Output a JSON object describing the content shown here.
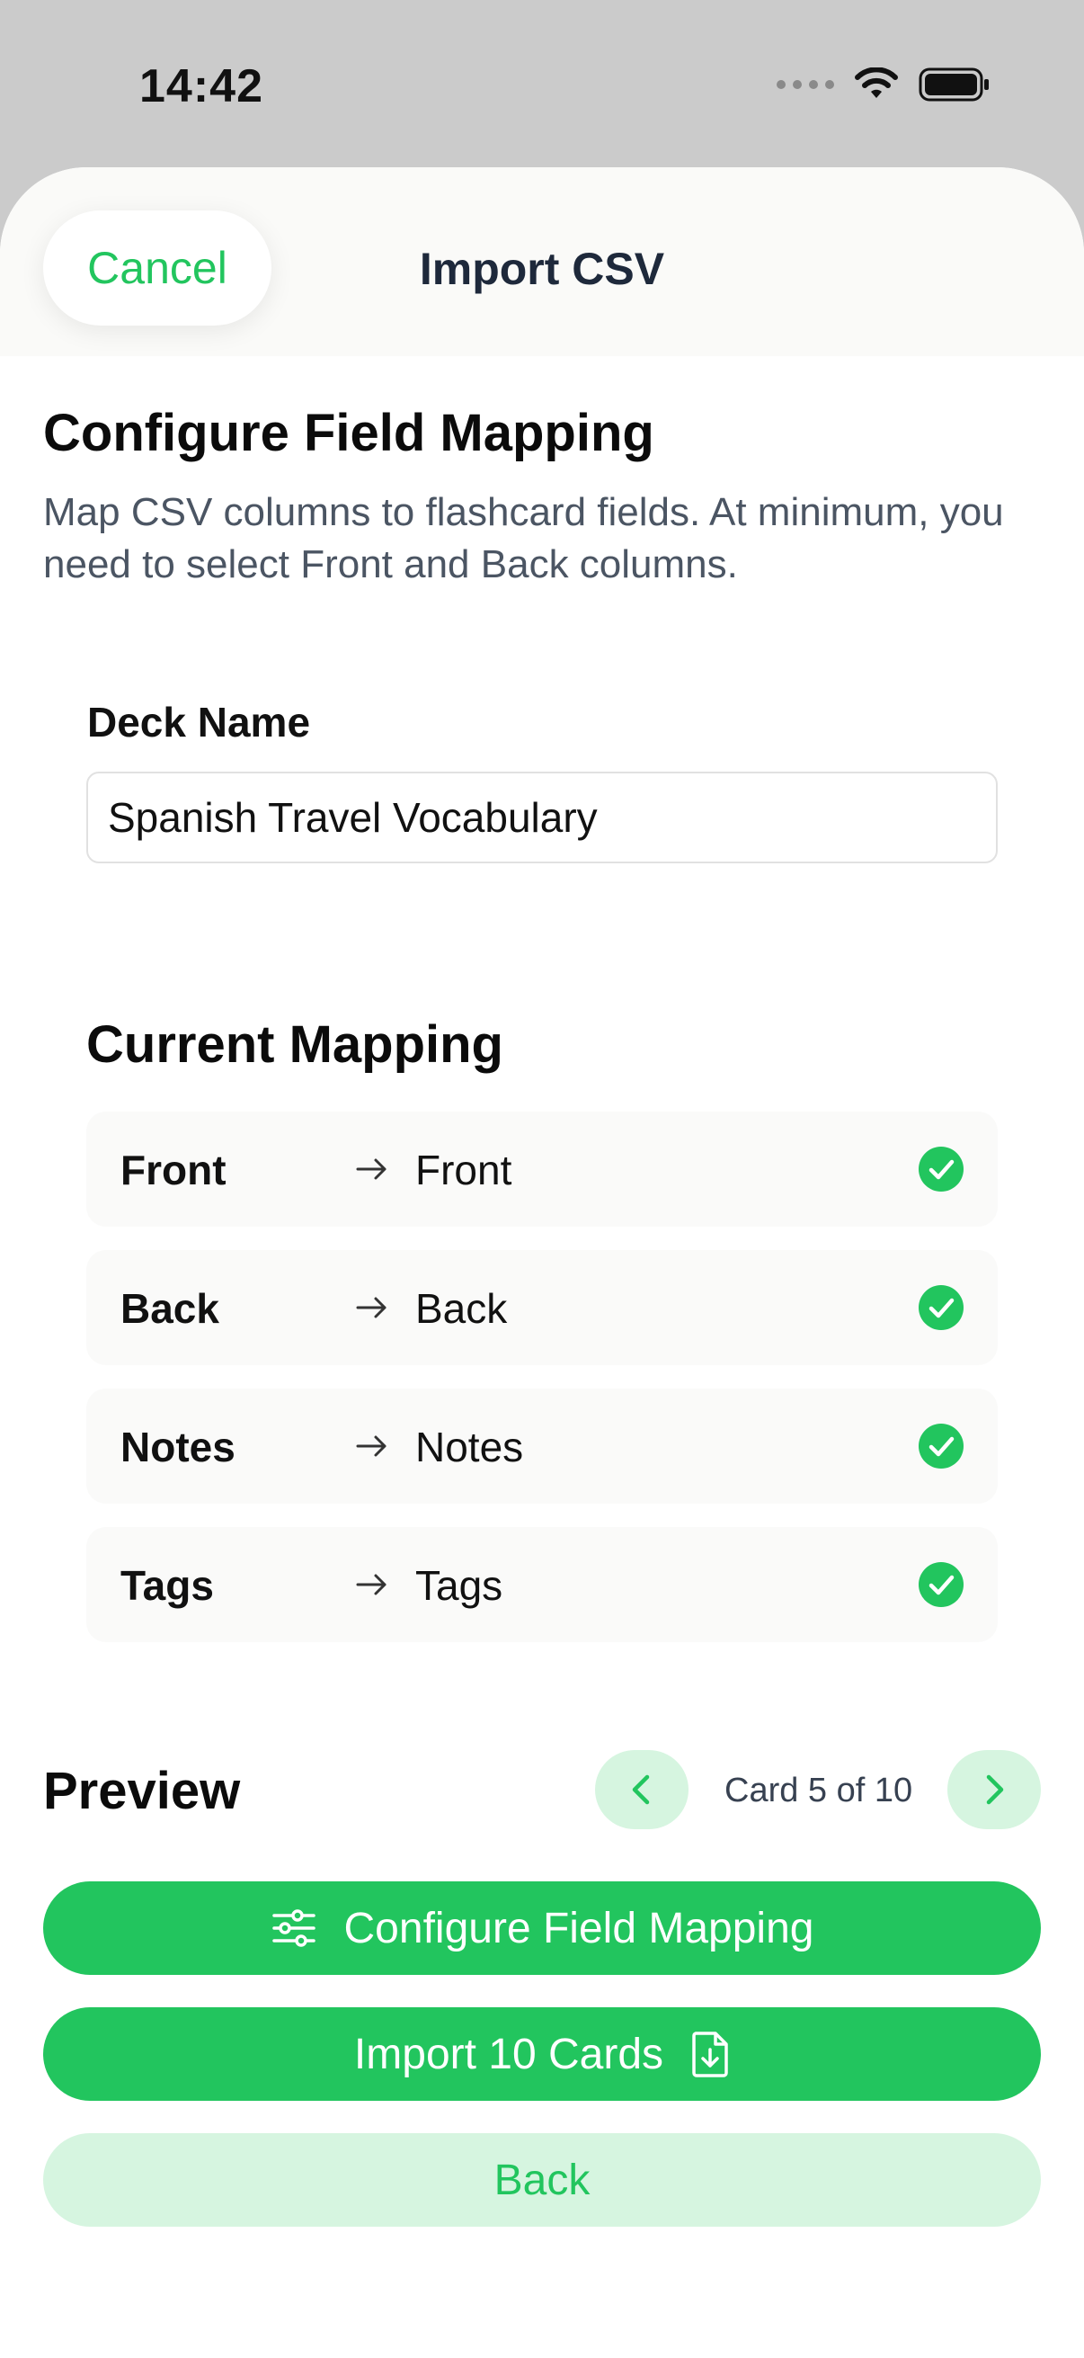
{
  "status_bar": {
    "time": "14:42"
  },
  "nav": {
    "cancel_label": "Cancel",
    "title": "Import CSV"
  },
  "content": {
    "heading": "Configure Field Mapping",
    "description": "Map CSV columns to flashcard fields. At minimum, you need to select Front and Back columns.",
    "deck_name_label": "Deck Name",
    "deck_name_value": "Spanish Travel Vocabulary",
    "mapping_heading": "Current Mapping",
    "mappings": [
      {
        "source": "Front",
        "target": "Front"
      },
      {
        "source": "Back",
        "target": "Back"
      },
      {
        "source": "Notes",
        "target": "Notes"
      },
      {
        "source": "Tags",
        "target": "Tags"
      }
    ]
  },
  "preview": {
    "heading": "Preview",
    "pager_label": "Card 5 of 10"
  },
  "actions": {
    "configure_label": "Configure Field Mapping",
    "import_label": "Import 10 Cards",
    "back_label": "Back"
  },
  "colors": {
    "accent": "#22c55e",
    "accent_soft": "#d6f5e0"
  },
  "icons": {
    "mapping_arrow": "arrow-right-icon",
    "mapping_status": "check-circle-icon",
    "configure": "sliders-icon",
    "import": "file-download-icon"
  }
}
